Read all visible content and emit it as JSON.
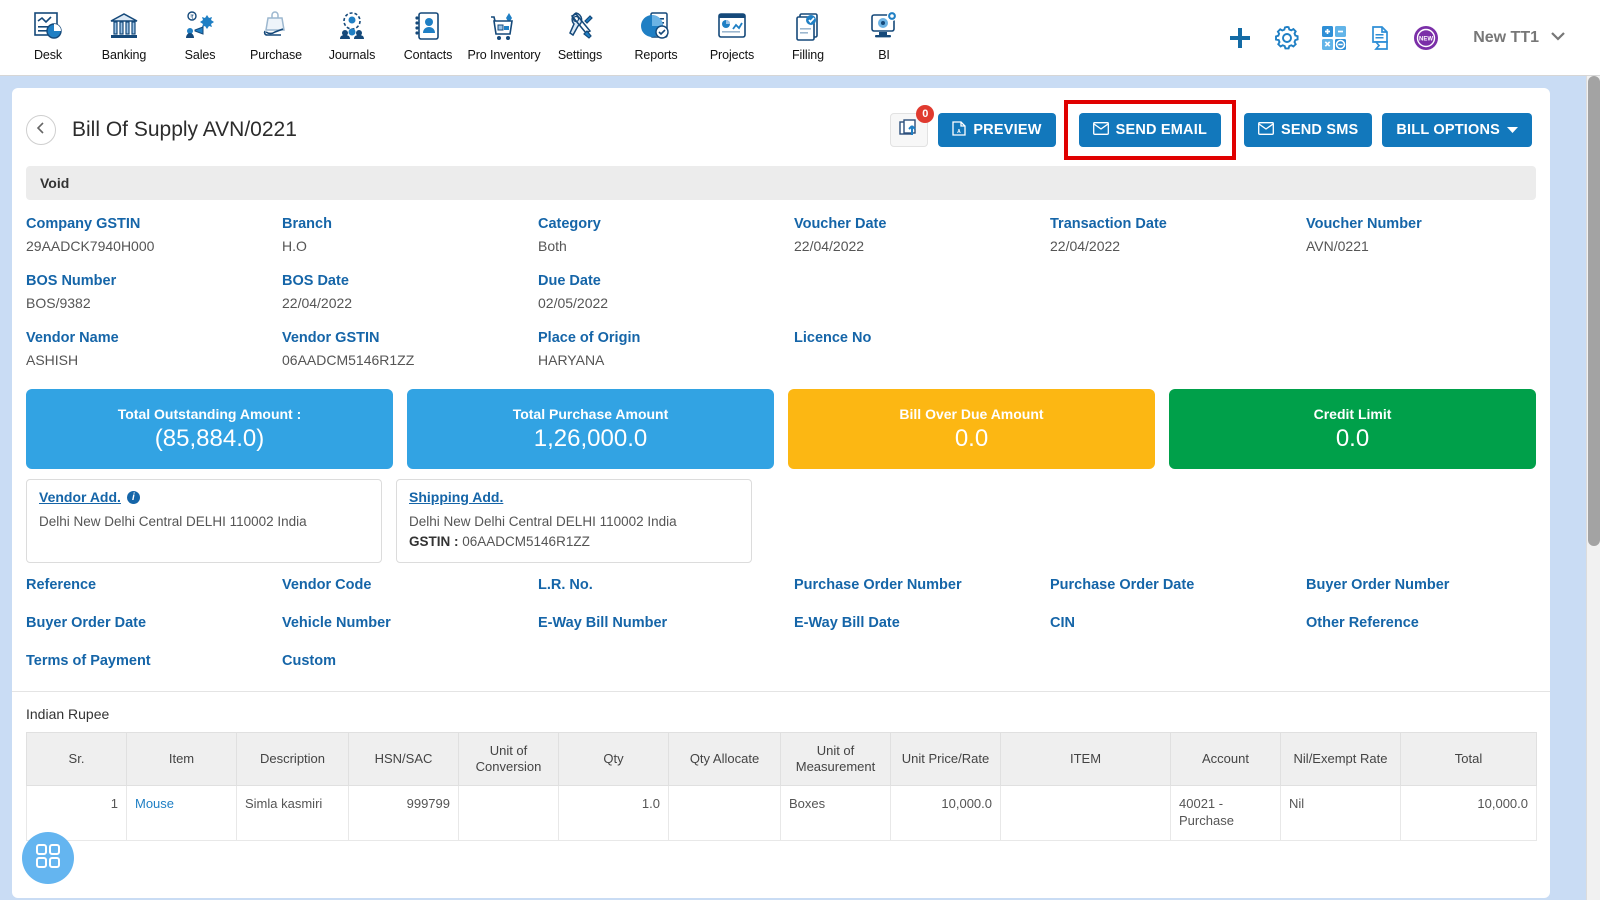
{
  "topnav": {
    "items": [
      {
        "label": "Desk",
        "icon": "dashboard-icon"
      },
      {
        "label": "Banking",
        "icon": "bank-icon"
      },
      {
        "label": "Sales",
        "icon": "sales-icon"
      },
      {
        "label": "Purchase",
        "icon": "purchase-icon"
      },
      {
        "label": "Journals",
        "icon": "journals-icon"
      },
      {
        "label": "Contacts",
        "icon": "contacts-icon"
      },
      {
        "label": "Pro Inventory",
        "icon": "inventory-icon"
      },
      {
        "label": "Settings",
        "icon": "settings-icon"
      },
      {
        "label": "Reports",
        "icon": "reports-icon"
      },
      {
        "label": "Projects",
        "icon": "projects-icon"
      },
      {
        "label": "Filling",
        "icon": "filling-icon"
      },
      {
        "label": "BI",
        "icon": "bi-icon"
      }
    ],
    "right_icons": [
      "plus-icon",
      "gear-icon",
      "calculator-icon",
      "document-icon",
      "new-badge-icon"
    ],
    "user_name": "New TT1",
    "user_chevron": "chevron-down-icon"
  },
  "document": {
    "back_icon": "chevron-left-icon",
    "title": "Bill Of Supply AVN/0221",
    "status_bar": "Void",
    "upload": {
      "icon": "file-upload-icon",
      "badge": "0"
    },
    "actions": [
      {
        "label": "PREVIEW",
        "icon": "pdf-icon",
        "highlighted": false
      },
      {
        "label": "SEND EMAIL",
        "icon": "envelope-icon",
        "highlighted": true
      },
      {
        "label": "SEND SMS",
        "icon": "envelope-icon",
        "highlighted": false
      },
      {
        "label": "BILL OPTIONS",
        "icon": "caret-down-icon",
        "highlighted": false
      }
    ],
    "highlight_color": "#e00000",
    "button_color": "#1278bc"
  },
  "fields": {
    "row1": [
      {
        "label": "Company GSTIN",
        "value": "29AADCK7940H000"
      },
      {
        "label": "Branch",
        "value": "H.O"
      },
      {
        "label": "Category",
        "value": "Both"
      },
      {
        "label": "Voucher Date",
        "value": "22/04/2022"
      },
      {
        "label": "Transaction Date",
        "value": "22/04/2022"
      },
      {
        "label": "Voucher Number",
        "value": "AVN/0221"
      }
    ],
    "row2": [
      {
        "label": "BOS Number",
        "value": "BOS/9382"
      },
      {
        "label": "BOS Date",
        "value": "22/04/2022"
      },
      {
        "label": "Due Date",
        "value": "02/05/2022"
      },
      {
        "label": "",
        "value": ""
      },
      {
        "label": "",
        "value": ""
      },
      {
        "label": "",
        "value": ""
      }
    ],
    "row3": [
      {
        "label": "Vendor Name",
        "value": "ASHISH"
      },
      {
        "label": "Vendor GSTIN",
        "value": "06AADCM5146R1ZZ"
      },
      {
        "label": "Place of Origin",
        "value": "HARYANA"
      },
      {
        "label": "Licence No",
        "value": ""
      },
      {
        "label": "",
        "value": ""
      },
      {
        "label": "",
        "value": ""
      }
    ]
  },
  "summary_cards": [
    {
      "label": "Total Outstanding Amount :",
      "value": "(85,884.0)",
      "color": "#32a3e3"
    },
    {
      "label": "Total Purchase Amount",
      "value": "1,26,000.0",
      "color": "#32a3e3"
    },
    {
      "label": "Bill Over Due Amount",
      "value": "0.0",
      "color": "#fcb713"
    },
    {
      "label": "Credit Limit",
      "value": "0.0",
      "color": "#00a04a"
    }
  ],
  "addresses": [
    {
      "title": "Vendor Add.",
      "has_info_icon": true,
      "line1": "Delhi New Delhi Central DELHI 110002 India",
      "gstin_label": "",
      "gstin_value": ""
    },
    {
      "title": "Shipping Add.",
      "has_info_icon": false,
      "line1": "Delhi New Delhi Central DELHI 110002 India",
      "gstin_label": "GSTIN :",
      "gstin_value": "06AADCM5146R1ZZ"
    }
  ],
  "label_rows": [
    [
      "Reference",
      "Vendor Code",
      "L.R. No.",
      "Purchase Order Number",
      "Purchase Order Date",
      "Buyer Order Number"
    ],
    [
      "Buyer Order Date",
      "Vehicle Number",
      "E-Way Bill Number",
      "E-Way Bill Date",
      "CIN",
      "Other Reference"
    ],
    [
      "Terms of Payment",
      "Custom",
      "",
      "",
      "",
      ""
    ]
  ],
  "table": {
    "currency": "Indian Rupee",
    "headers": [
      "Sr.",
      "Item",
      "Description",
      "HSN/SAC",
      "Unit of Conversion",
      "Qty",
      "Qty Allocate",
      "Unit of Measurement",
      "Unit Price/Rate",
      "ITEM",
      "Account",
      "Nil/Exempt Rate",
      "Total"
    ],
    "rows": [
      {
        "sr": "1",
        "item": "Mouse",
        "description": "Simla kasmiri",
        "hsn_sac": "999799",
        "unit_of_conversion": "",
        "qty": "1.0",
        "qty_allocate": "",
        "unit_of_measurement": "Boxes",
        "unit_price_rate": "10,000.0",
        "item_col": "",
        "account": "40021 - Purchase",
        "nil_exempt_rate": "Nil",
        "total": "10,000.0"
      }
    ]
  },
  "fab": {
    "icon": "grid-apps-icon"
  }
}
